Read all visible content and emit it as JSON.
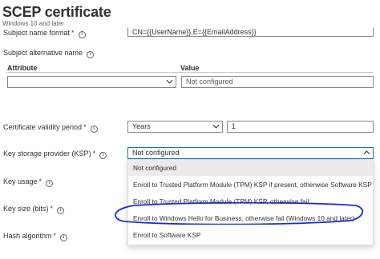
{
  "header": {
    "title": "SCEP certificate",
    "subtitle": "Windows 10 and later",
    "more_label": "···"
  },
  "subject_name_format": {
    "label": "Subject name format",
    "required_mark": "*",
    "value": "CN={{UserName}},E={{EmailAddress}}"
  },
  "san": {
    "label": "Subject alternative name",
    "columns": [
      "Attribute",
      "Value"
    ],
    "value_placeholder": "Not configured"
  },
  "validity": {
    "label": "Certificate validity period",
    "required_mark": "*",
    "unit": "Years",
    "amount": "1"
  },
  "ksp": {
    "label": "Key storage provider (KSP)",
    "required_mark": "*",
    "value": "Not configured",
    "options": [
      "Not configured",
      "Enroll to Trusted Platform Module (TPM) KSP if present, otherwise Software KSP",
      "Enroll to Trusted Platform Module (TPM) KSP, otherwise fail",
      "Enroll to Windows Hello for Business, otherwise fail (Windows 10 and later)",
      "Enroll to Software KSP"
    ],
    "highlighted_option_index": 0,
    "circled_option_index": 3
  },
  "key_usage": {
    "label": "Key usage",
    "required_mark": "*"
  },
  "key_size": {
    "label": "Key size (bits)",
    "required_mark": "*"
  },
  "hash_algorithm": {
    "label": "Hash algorithm",
    "required_mark": "*"
  },
  "colors": {
    "accent": "#0078d4",
    "annotation": "#1a2bd6",
    "required": "#a4262c"
  }
}
